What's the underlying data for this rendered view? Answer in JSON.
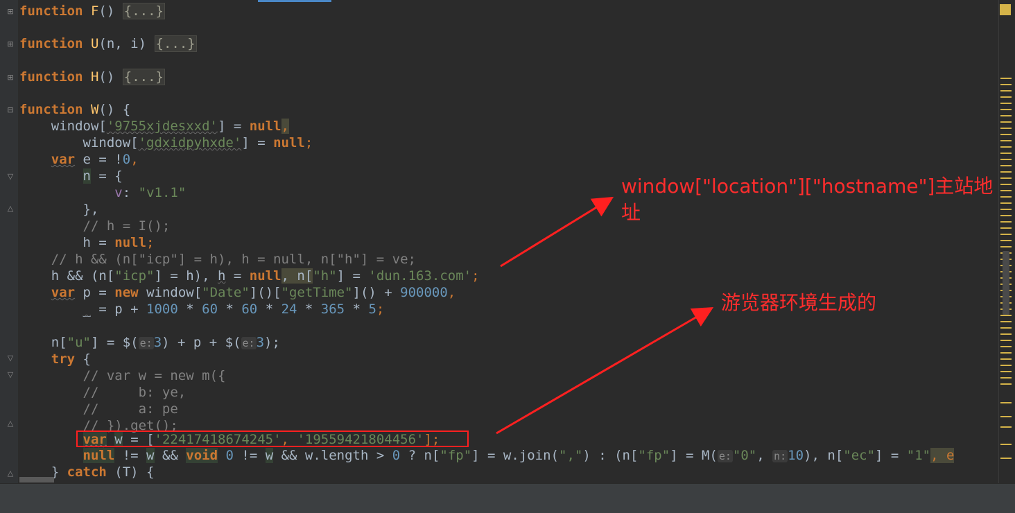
{
  "code": {
    "l1": {
      "kw": "function",
      "name": "F",
      "rest": "() ",
      "fold": "{...}"
    },
    "l2": {
      "kw": "function",
      "name": "U",
      "rest": "(n, i) ",
      "fold": "{...}"
    },
    "l3": {
      "kw": "function",
      "name": "H",
      "rest": "() ",
      "fold": "{...}"
    },
    "l4": {
      "kw": "function",
      "name": "W",
      "rest": "() {"
    },
    "l5": {
      "a": "window[",
      "s": "'9755xjdesxxd'",
      "b": "] = ",
      "k": "null",
      "c": ","
    },
    "l6": {
      "a": "window[",
      "s": "'gdxidpyhxde'",
      "b": "] = ",
      "k": "null",
      "c": ";"
    },
    "l7": {
      "k": "var",
      "a": " e = !",
      "n": "0",
      "c": ","
    },
    "l8": {
      "v": "n",
      "a": " = {"
    },
    "l9": {
      "p": "v",
      "a": ": ",
      "s": "\"v1.1\""
    },
    "l10": {
      "a": "},"
    },
    "l11": {
      "c": "// h = I();"
    },
    "l12": {
      "a": "h = ",
      "k": "null",
      "c": ";"
    },
    "l13": {
      "c": "// h && (n[\"icp\"] = h), h = null, n[\"h\"] = ve;"
    },
    "l14": {
      "a": "h && (n[",
      "s1": "\"icp\"",
      "b": "] = h), ",
      "h": "h",
      "d": " = ",
      "k": "null",
      "e": ", n[",
      "s2": "\"h\"",
      "f": "] = ",
      "s3": "'dun.163.com'",
      "g": ";"
    },
    "l15": {
      "k": "var",
      "a": " p = ",
      "k2": "new",
      "b": " window[",
      "s1": "\"Date\"",
      "c": "]()[",
      "s2": "\"getTime\"",
      "d": "]() + ",
      "n": "900000",
      "e": ","
    },
    "l16": {
      "v": "_",
      "a": " = p + ",
      "n1": "1000",
      "b": " * ",
      "n2": "60",
      "c": " * ",
      "n3": "60",
      "d": " * ",
      "n4": "24",
      "e": " * ",
      "n5": "365",
      "f": " * ",
      "n6": "5",
      "g": ";"
    },
    "l17": {
      "a": "n[",
      "s": "\"u\"",
      "b": "] = $(",
      "h1": "e:",
      "n1": "3",
      "c": ") + p + $(",
      "h2": "e:",
      "n2": "3",
      "d": ");"
    },
    "l18": {
      "k": "try",
      "a": " {"
    },
    "l19": {
      "c": "// var w = new m({"
    },
    "l20": {
      "c": "//     b: ye,"
    },
    "l21": {
      "c": "//     a: pe"
    },
    "l22": {
      "c": "// }).get();"
    },
    "l23": {
      "k": "var",
      "a": " ",
      "v": "w",
      "b": " = [",
      "s1": "'22417418674245'",
      "c": ", ",
      "s2": "'19559421804456'",
      "d": "];"
    },
    "l24": {
      "k1": "null",
      "a": " != ",
      "v1": "w",
      "b": " && ",
      "k2": "void",
      "c": " ",
      "n0": "0",
      "d": " != ",
      "v2": "w",
      "e": " && w.length > ",
      "n1": "0",
      "f": " ? n[",
      "s1": "\"fp\"",
      "g": "] = w.join(",
      "s2": "\",\"",
      "h": ") : (n[",
      "s3": "\"fp\"",
      "i": "] = M(",
      "h1": "e:",
      "s4": "\"0\"",
      "j": ", ",
      "h2": "n:",
      "n2": "10",
      "k": "), n[",
      "s5": "\"ec\"",
      "l": "] = ",
      "s6": "\"1\"",
      "m": ", e"
    },
    "l25": {
      "a": "} ",
      "k": "catch",
      "b": " (T) {"
    }
  },
  "annotations": {
    "top": "window[\"location\"][\"hostname\"]主站地址",
    "bottom": "游览器环境生成的"
  },
  "colors": {
    "annotation": "#ff2d2d",
    "keyword": "#cc7832",
    "string": "#6a8759",
    "number": "#6897bb",
    "comment": "#808080"
  }
}
